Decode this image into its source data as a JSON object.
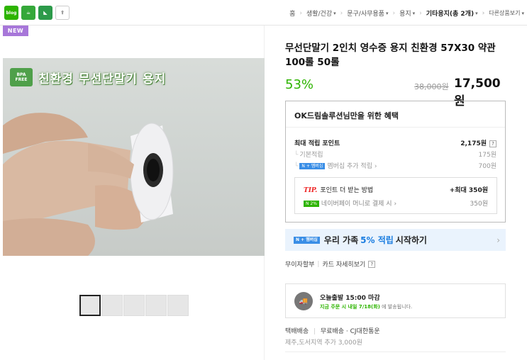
{
  "share": {
    "blog_label": "blog",
    "share_icons": [
      "blog-icon",
      "cafe-icon",
      "kstar-icon",
      "share-icon"
    ]
  },
  "breadcrumb": {
    "items": [
      {
        "label": "홈",
        "has_caret": false
      },
      {
        "label": "생활/건강",
        "has_caret": true
      },
      {
        "label": "문구/사무용품",
        "has_caret": true
      },
      {
        "label": "용지",
        "has_caret": true
      },
      {
        "label": "기타용지(총 2개)",
        "has_caret": true,
        "current": true
      },
      {
        "label": "다른상품보기",
        "has_caret": true
      }
    ]
  },
  "gallery": {
    "badge": "NEW",
    "image_caption": "친환경 무선단말기 용지",
    "eco_logo_text": "BPA FREE",
    "thumb_count": 5,
    "selected_thumb": 0
  },
  "product": {
    "title": "무선단말기 2인치 영수증 용지 친환경 57X30 약관 100롤 50롤",
    "discount": "53%",
    "original_price": "38,000원",
    "sale_price": "17,500원"
  },
  "benefit": {
    "heading": "OK드림솔루션님만을 위한 혜택",
    "max_points_label": "최대 적립 포인트",
    "max_points_value": "2,175원",
    "base_label": "기본적립",
    "base_value": "175원",
    "member_badge": "N + 멤버십",
    "member_label": "멤버십 추가 적립",
    "member_value": "700원",
    "tip_label": "TIP.",
    "tip_title": "포인트 더 받는 방법",
    "tip_max": "+최대 350원",
    "pay_badge": "N 2%",
    "pay_label": "네이버페이 머니로 결제 시",
    "pay_value": "350원"
  },
  "membership_banner": {
    "badge": "N + 멤버십",
    "prefix": "우리 가족",
    "pct": "5% 적립",
    "suffix": "시작하기"
  },
  "installment": {
    "label1": "무이자할부",
    "label2": "카드 자세히보기"
  },
  "shipping": {
    "title": "오늘출발 15:00 마감",
    "sub_green": "지금 주문 시 내일 7/18(화)",
    "sub_rest": "에 발송됩니다."
  },
  "delivery": {
    "type": "택배배송",
    "fee": "무료배송 · CJ대한통운",
    "extra": "제주,도서지역 추가 3,000원"
  }
}
